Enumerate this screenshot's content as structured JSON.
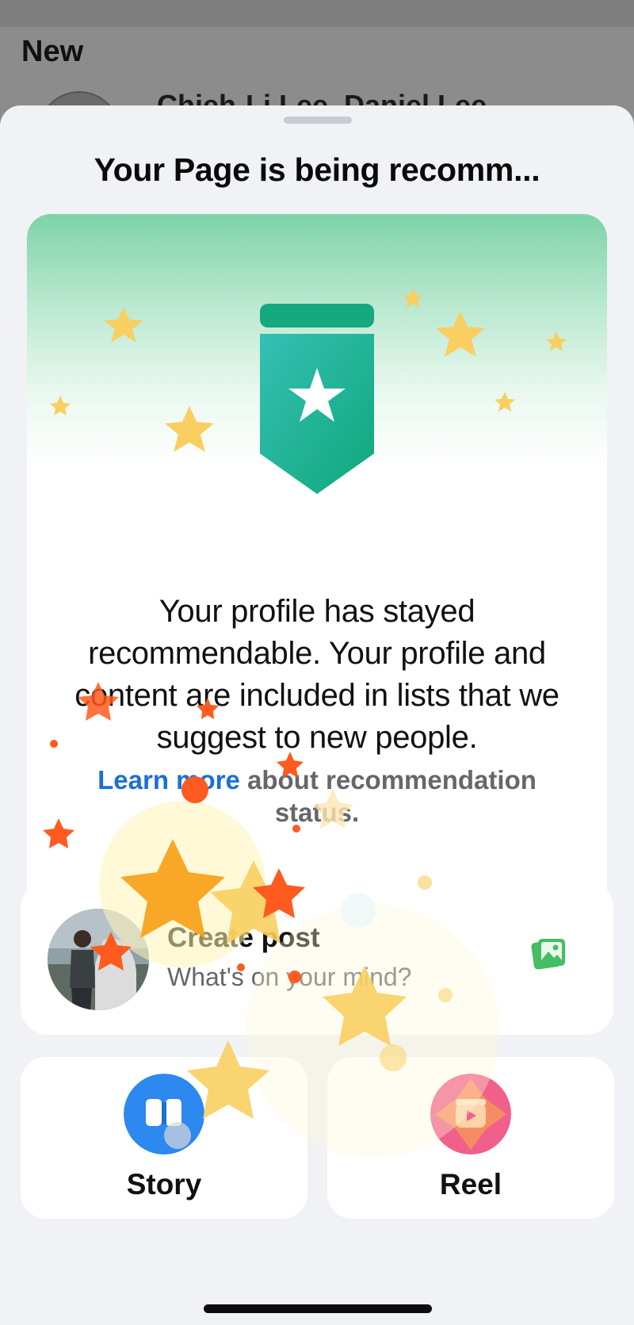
{
  "background": {
    "section_label": "New",
    "peek_name": "Chieh-Li Lee, Daniel Lee"
  },
  "sheet": {
    "title": "Your Page is being recomm..."
  },
  "hero": {
    "icon": "recommendation-badge-icon",
    "message": "Your profile has stayed recommendable. Your profile and content are included in lists that we suggest to new people.",
    "learn_more_link": "Learn more",
    "learn_more_rest": " about recommendation status."
  },
  "create_post": {
    "title": "Create post",
    "subtitle": "What's on your mind?",
    "icon": "photo-icon"
  },
  "tiles": {
    "story_label": "Story",
    "reel_label": "Reel"
  },
  "colors": {
    "link": "#1b6fd8",
    "badge_top": "#13a97d",
    "badge_bottom": "#2db5a4",
    "star_yellow": "#f8cf60",
    "confetti_orange": "#ff5a1f",
    "story_blue": "#2d88f0",
    "reel_pink": "#f0608a"
  }
}
